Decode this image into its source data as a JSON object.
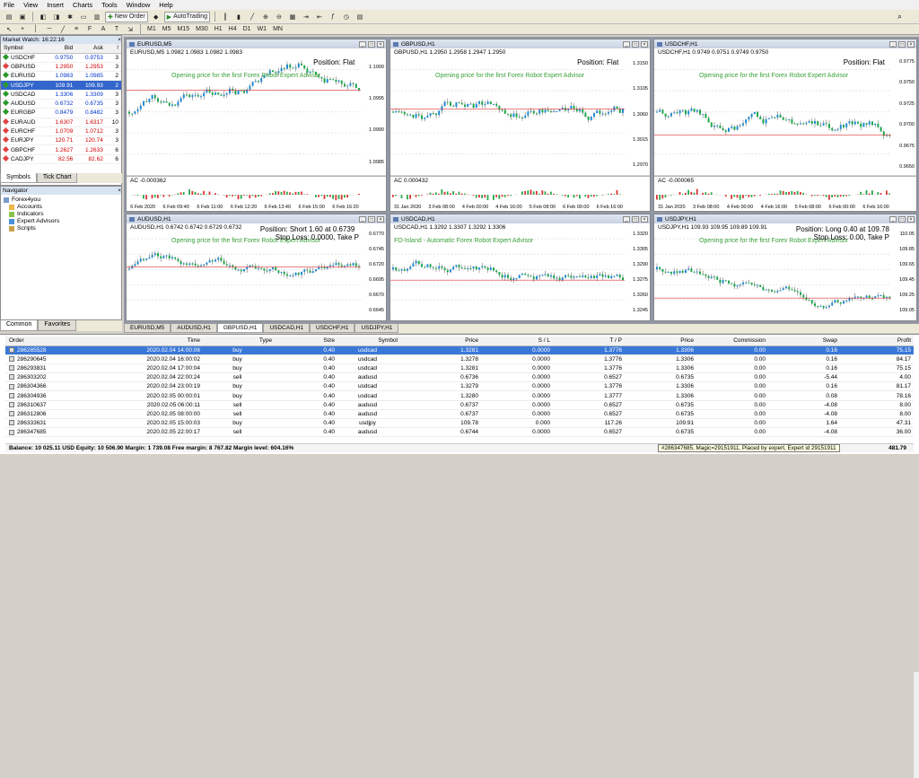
{
  "menu": [
    "File",
    "View",
    "Insert",
    "Charts",
    "Tools",
    "Window",
    "Help"
  ],
  "toolbar": {
    "new_order": "New Order",
    "autotrading": "AutoTrading",
    "timeframes": [
      "M1",
      "M5",
      "M15",
      "M30",
      "H1",
      "H4",
      "D1",
      "W1",
      "MN"
    ]
  },
  "market_watch": {
    "title": "Market Watch: 16:22:16",
    "headers": [
      "Symbol",
      "Bid",
      "Ask",
      "!"
    ],
    "rows": [
      {
        "s": "USDCHF",
        "b": "0.9750",
        "a": "0.9753",
        "sp": "3",
        "d": "up"
      },
      {
        "s": "GBPUSD",
        "b": "1.2950",
        "a": "1.2953",
        "sp": "3",
        "d": "dn"
      },
      {
        "s": "EURUSD",
        "b": "1.0983",
        "a": "1.0985",
        "sp": "2",
        "d": "up"
      },
      {
        "s": "USDJPY",
        "b": "109.91",
        "a": "109.93",
        "sp": "2",
        "d": "up"
      },
      {
        "s": "USDCAD",
        "b": "1.3306",
        "a": "1.3309",
        "sp": "3",
        "d": "up"
      },
      {
        "s": "AUDUSD",
        "b": "0.6732",
        "a": "0.6735",
        "sp": "3",
        "d": "up"
      },
      {
        "s": "EURGBP",
        "b": "0.8479",
        "a": "0.8482",
        "sp": "3",
        "d": "up"
      },
      {
        "s": "EURAUD",
        "b": "1.6307",
        "a": "1.6317",
        "sp": "10",
        "d": "dn"
      },
      {
        "s": "EURCHF",
        "b": "1.0709",
        "a": "1.0712",
        "sp": "3",
        "d": "dn"
      },
      {
        "s": "EURJPY",
        "b": "120.71",
        "a": "120.74",
        "sp": "3",
        "d": "dn"
      },
      {
        "s": "GBPCHF",
        "b": "1.2627",
        "a": "1.2633",
        "sp": "6",
        "d": "dn"
      },
      {
        "s": "CADJPY",
        "b": "82.56",
        "a": "82.62",
        "sp": "6",
        "d": "dn"
      }
    ],
    "tabs": [
      "Symbols",
      "Tick Chart"
    ]
  },
  "navigator": {
    "title": "Navigator",
    "items": [
      "Forex4you",
      "Accounts",
      "Indicators",
      "Expert Advisors",
      "Scripts"
    ],
    "tabs": [
      "Common",
      "Favorites"
    ]
  },
  "charts": [
    {
      "title": "EURUSD,M5",
      "info": "EURUSD,M5 1.0982 1.0983 1.0982 1.0983",
      "ea": "Opening price for the first Forex Robot Expert Advisor",
      "pos": "Position: Flat",
      "prices": [
        "1.1000",
        "1.0995",
        "1.0990",
        "1.0985"
      ],
      "times": [
        "6 Feb 2020",
        "6 Feb 09:40",
        "6 Feb 11:00",
        "6 Feb 12:20",
        "6 Feb 13:40",
        "6 Feb 15:00",
        "6 Feb 16:20"
      ],
      "ac": "AC -0.000362"
    },
    {
      "title": "GBPUSD,H1",
      "info": "GBPUSD,H1 1.2950 1.2958 1.2947 1.2950",
      "ea": "Opening price for the first Forex Robot Expert Advisor",
      "pos": "Position: Flat",
      "prices": [
        "1.3150",
        "1.3105",
        "1.3060",
        "1.3015",
        "1.2970"
      ],
      "times": [
        "31 Jan 2020",
        "3 Feb 08:00",
        "4 Feb 00:00",
        "4 Feb 16:00",
        "5 Feb 08:00",
        "6 Feb 00:00",
        "6 Feb 16:00"
      ],
      "ac": "AC 0.000432"
    },
    {
      "title": "USDCHF,H1",
      "info": "USDCHF,H1 0.9749 0.9751 0.9749 0.9750",
      "ea": "Opening price for the first Forex Robot Expert Advisor",
      "pos": "Position: Flat",
      "prices": [
        "0.9775",
        "0.9750",
        "0.9725",
        "0.9700",
        "0.9675",
        "0.9650"
      ],
      "times": [
        "31 Jan 2020",
        "3 Feb 08:00",
        "4 Feb 00:00",
        "4 Feb 16:00",
        "5 Feb 08:00",
        "6 Feb 00:00",
        "6 Feb 16:00"
      ],
      "ac": "AC -0.000065"
    },
    {
      "title": "AUDUSD,H1",
      "info": "AUDUSD,H1 0.6742 0.6742 0.6729 0.6732",
      "ea": "Opening price for the first Forex Robot Expert Advisor",
      "pos": "Position: Short 1.60 at 0.6739",
      "pos2": "Stop Loss: 0.0000, Take P",
      "prices": [
        "0.6770",
        "0.6745",
        "0.6720",
        "0.6695",
        "0.6670",
        "0.6645"
      ],
      "times": []
    },
    {
      "title": "USDCAD,H1",
      "info": "USDCAD,H1 1.3292 1.3307 1.3292 1.3306",
      "ea": "FO-Island - Automatic Forex Robot Expert Advisor",
      "pos": "",
      "prices": [
        "1.3320",
        "1.3305",
        "1.3290",
        "1.3275",
        "1.3260",
        "1.3245"
      ],
      "times": []
    },
    {
      "title": "USDJPY,H1",
      "info": "USDJPY,H1 109.93 109.95 109.89 109.91",
      "ea": "Opening price for the first Forex Robot Expert Advisor",
      "pos": "Position: Long 0.40 at 109.78",
      "pos2": "Stop Loss: 0.00, Take P",
      "prices": [
        "110.05",
        "109.85",
        "109.65",
        "109.45",
        "109.25",
        "109.05"
      ],
      "times": []
    }
  ],
  "chart_tabs": [
    "EURUSD,M5",
    "AUDUSD,H1",
    "GBPUSD,H1",
    "USDCAD,H1",
    "USDCHF,H1",
    "USDJPY,H1"
  ],
  "terminal": {
    "headers": [
      "Order",
      "Time",
      "Type",
      "Size",
      "Symbol",
      "Price",
      "S / L",
      "T / P",
      "Price",
      "Commission",
      "Swap",
      "Profit"
    ],
    "rows": [
      [
        "286285528",
        "2020.02.04 14:00:06",
        "buy",
        "0.40",
        "usdcad",
        "1.3281",
        "0.0000",
        "1.3776",
        "1.3306",
        "0.00",
        "0.16",
        "75.15"
      ],
      [
        "286290645",
        "2020.02.04 16:00:02",
        "buy",
        "0.40",
        "usdcad",
        "1.3278",
        "0.0000",
        "1.3776",
        "1.3306",
        "0.00",
        "0.16",
        "84.17"
      ],
      [
        "286293831",
        "2020.02.04 17:00:04",
        "buy",
        "0.40",
        "usdcad",
        "1.3281",
        "0.0000",
        "1.3776",
        "1.3306",
        "0.00",
        "0.16",
        "75.15"
      ],
      [
        "286303202",
        "2020.02.04 22:00:24",
        "sell",
        "0.40",
        "audusd",
        "0.6736",
        "0.0000",
        "0.6527",
        "0.6735",
        "0.00",
        "-5.44",
        "4.00"
      ],
      [
        "286304366",
        "2020.02.04 23:00:19",
        "buy",
        "0.40",
        "usdcad",
        "1.3279",
        "0.0000",
        "1.3776",
        "1.3306",
        "0.00",
        "0.16",
        "81.17"
      ],
      [
        "286304936",
        "2020.02.05 00:00:01",
        "buy",
        "0.40",
        "usdcad",
        "1.3280",
        "0.0000",
        "1.3777",
        "1.3306",
        "0.00",
        "0.08",
        "78.16"
      ],
      [
        "286310637",
        "2020.02.05 06:00:11",
        "sell",
        "0.40",
        "audusd",
        "0.6737",
        "0.0000",
        "0.6527",
        "0.6735",
        "0.00",
        "-4.08",
        "8.00"
      ],
      [
        "286312806",
        "2020.02.05 08:00:00",
        "sell",
        "0.40",
        "audusd",
        "0.6737",
        "0.0000",
        "0.6527",
        "0.6735",
        "0.00",
        "-4.08",
        "8.00"
      ],
      [
        "286333631",
        "2020.02.05 15:00:03",
        "buy",
        "0.40",
        "usdjpy",
        "109.78",
        "0.000",
        "117.26",
        "109.91",
        "0.00",
        "1.64",
        "47.31"
      ],
      [
        "286347685",
        "2020.02.05 22:00:17",
        "sell",
        "0.40",
        "audusd",
        "0.6744",
        "0.0000",
        "0.6527",
        "0.6735",
        "0.00",
        "-4.08",
        "36.00"
      ]
    ],
    "balance": "Balance: 10 025.11 USD  Equity: 10 506.90  Margin: 1 739.08  Free margin: 8 767.82  Margin level: 604.16%",
    "total_profit": "481.79",
    "tooltip": "#286347685, Magic=29151911, Placed by expert, Expert id 29151911"
  }
}
